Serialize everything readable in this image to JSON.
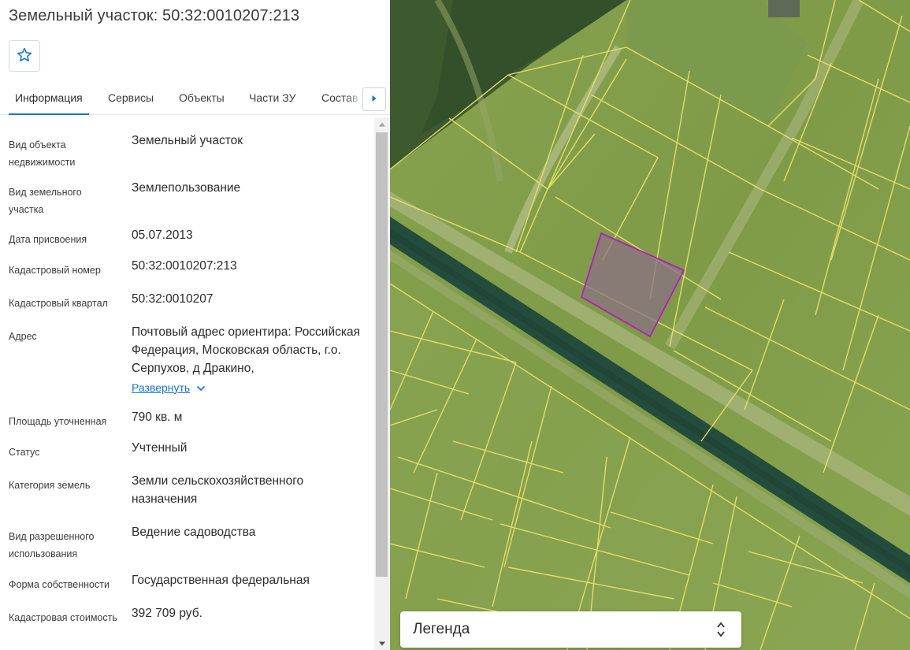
{
  "header": {
    "title": "Земельный участок: 50:32:0010207:213"
  },
  "favorite_icon": "star-outline-icon",
  "tabs": [
    {
      "label": "Информация",
      "active": true
    },
    {
      "label": "Сервисы",
      "active": false
    },
    {
      "label": "Объекты",
      "active": false
    },
    {
      "label": "Части ЗУ",
      "active": false
    },
    {
      "label": "Состав",
      "active": false
    }
  ],
  "info": {
    "rows": [
      {
        "label": "Вид объекта недвижимости",
        "value": "Земельный участок"
      },
      {
        "label": "Вид земельного участка",
        "value": "Землепользование"
      },
      {
        "label": "Дата присвоения",
        "value": "05.07.2013"
      },
      {
        "label": "Кадастровый номер",
        "value": "50:32:0010207:213"
      },
      {
        "label": "Кадастровый квартал",
        "value": "50:32:0010207"
      },
      {
        "label": "Адрес",
        "value": "Почтовый адрес ориентира: Российская Федерация, Московская область, г.о. Серпухов, д Дракино,"
      },
      {
        "label": "Площадь уточненная",
        "value": "790 кв. м"
      },
      {
        "label": "Статус",
        "value": "Учтенный"
      },
      {
        "label": "Категория земель",
        "value": "Земли сельскохозяйственного назначения"
      },
      {
        "label": "Вид разрешенного использования",
        "value": "Ведение садоводства"
      },
      {
        "label": "Форма собственности",
        "value": "Государственная федеральная"
      },
      {
        "label": "Кадастровая стоимость",
        "value": "392 709 руб."
      }
    ],
    "expand_label": "Развернуть"
  },
  "map": {
    "legend_label": "Легенда",
    "parcel_outline_color": "#b01fb8",
    "boundary_color": "#e8e06a"
  },
  "colors": {
    "accent": "#1a73c7",
    "text": "#333333"
  }
}
